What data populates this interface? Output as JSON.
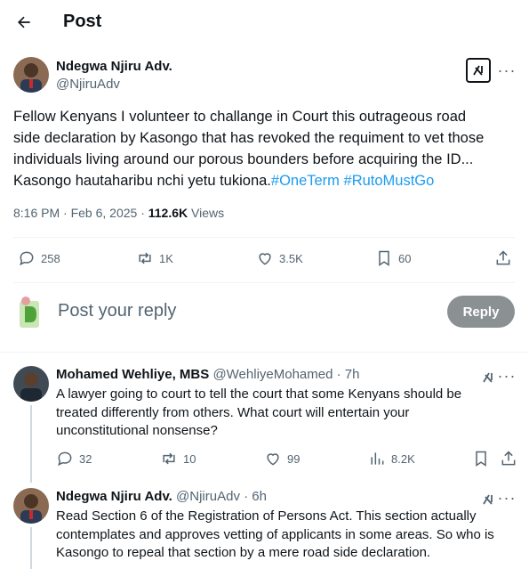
{
  "header": {
    "title": "Post"
  },
  "post": {
    "author_name": "Ndegwa Njiru Adv.",
    "author_handle": "@NjiruAdv",
    "text_line1": "Fellow Kenyans I volunteer to challange in Court this outrageous road",
    "text_line2": "side declaration by Kasongo that has revoked the requiment to vet those",
    "text_line3": "individuals living around our porous bounders before acquiring the ID...",
    "text_line4": "Kasongo hautaharibu nchi yetu tukiona.",
    "hashtag1": "#OneTerm",
    "hashtag2": "#RutoMustGo",
    "time": "8:16 PM · Feb 6, 2025 · ",
    "views_count": "112.6K",
    "views_label": " Views",
    "replies": "258",
    "reposts": "1K",
    "likes": "3.5K",
    "bookmarks": "60"
  },
  "reply_box": {
    "placeholder": "Post your reply",
    "button_label": "Reply"
  },
  "comments": [
    {
      "author_name": "Mohamed Wehliye, MBS",
      "handle_time": "@WehliyeMohamed · 7h",
      "line1": "A lawyer going to court to tell the court that some Kenyans should be",
      "line2": "treated differently from others. What court will entertain your",
      "line3": "unconstitutional nonsense?",
      "replies": "32",
      "reposts": "10",
      "likes": "99",
      "views": "8.2K"
    },
    {
      "author_name": "Ndegwa Njiru Adv.",
      "handle_time": "@NjiruAdv · 6h",
      "line1": "Read Section 6 of the Registration of Persons Act. This section actually",
      "line2": "contemplates and approves vetting of applicants in some areas. So who is",
      "line3": "Kasongo to repeal that section by a mere road side declaration."
    }
  ],
  "icons": {
    "back": "arrow-left-icon",
    "grok": "grok-icon",
    "more": "more-icon",
    "reply": "speech-bubble-icon",
    "repost": "repost-icon",
    "like": "heart-icon",
    "bookmark": "bookmark-icon",
    "share": "share-icon",
    "views": "bar-chart-icon"
  },
  "colors": {
    "link": "#1d9bf0",
    "secondary_text": "#536471",
    "reply_button": "#8b9093"
  }
}
